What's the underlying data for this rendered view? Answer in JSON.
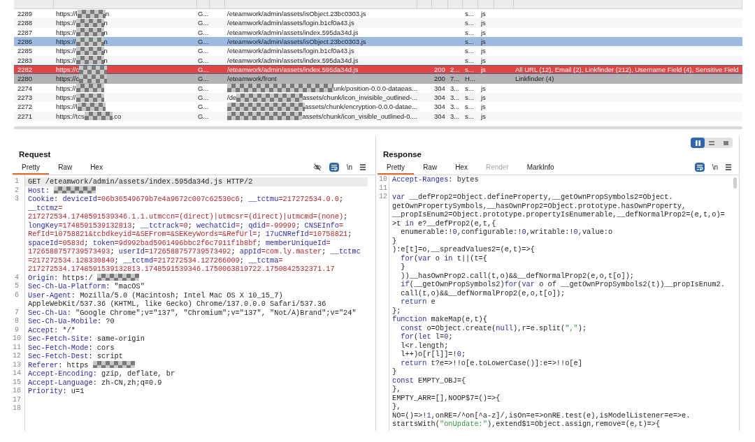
{
  "table": {
    "rows": [
      {
        "num": "2289",
        "host": [
          {
            "kind": "plain",
            "text": "https://l"
          },
          {
            "kind": "redacted"
          },
          {
            "kind": "plain",
            "text": "n"
          }
        ],
        "method": "G...",
        "url": [
          {
            "kind": "plain",
            "text": "/eteamwork/admin/assets/isObject.23bc0303.js"
          }
        ],
        "mime": "s...",
        "ext": "js",
        "selected": false
      },
      {
        "num": "2288",
        "host": [
          {
            "kind": "plain",
            "text": "https://"
          },
          {
            "kind": "redacted"
          },
          {
            "kind": "plain",
            "text": "n"
          }
        ],
        "method": "G...",
        "url": [
          {
            "kind": "plain",
            "text": "/eteamwork/admin/assets/login.b1cf0a43.js"
          }
        ],
        "mime": "s...",
        "ext": "js",
        "selected": false
      },
      {
        "num": "2287",
        "host": [
          {
            "kind": "plain",
            "text": "https://"
          },
          {
            "kind": "redacted"
          },
          {
            "kind": "plain",
            "text": "n"
          }
        ],
        "method": "G...",
        "url": [
          {
            "kind": "plain",
            "text": "/eteamwork/admin/assets/index.595da34d.js"
          }
        ],
        "mime": "s...",
        "ext": "js",
        "selected": false
      },
      {
        "num": "2286",
        "host": [
          {
            "kind": "plain",
            "text": "https://"
          },
          {
            "kind": "redacted"
          },
          {
            "kind": "plain",
            "text": "n"
          }
        ],
        "method": "G...",
        "url": [
          {
            "kind": "plain",
            "text": "/eteamwork/admin/assets/isObject.23bc0303.js"
          }
        ],
        "mime": "s...",
        "ext": "js",
        "selected": false,
        "color": "#9dbbe2"
      },
      {
        "num": "2285",
        "host": [
          {
            "kind": "plain",
            "text": "https://"
          },
          {
            "kind": "redacted"
          },
          {
            "kind": "plain",
            "text": "n"
          }
        ],
        "method": "G...",
        "url": [
          {
            "kind": "plain",
            "text": "/eteamwork/admin/assets/login.b1cf0a43.js"
          }
        ],
        "mime": "s...",
        "ext": "js",
        "selected": false
      },
      {
        "num": "2283",
        "host": [
          {
            "kind": "plain",
            "text": "https://"
          },
          {
            "kind": "redacted"
          },
          {
            "kind": "plain",
            "text": "n"
          }
        ],
        "method": "G...",
        "url": [
          {
            "kind": "plain",
            "text": "/eteamwork/admin/assets/index.595da34d.js"
          }
        ],
        "mime": "s...",
        "ext": "js",
        "selected": false
      },
      {
        "num": "2282",
        "host": [
          {
            "kind": "plain",
            "text": "https://c"
          },
          {
            "kind": "redacted"
          }
        ],
        "method": "G...",
        "url": [
          {
            "kind": "plain",
            "text": "/eteamwork/admin/assets/index.595da34d.js"
          }
        ],
        "status": "200",
        "length": "2...",
        "mime": "s...",
        "ext": "js",
        "notes": "All URL (12), Email (2), Linkfinder (212), Username Field (4), Sensitive Field",
        "selected": true,
        "color": "#df4646"
      },
      {
        "num": "2280",
        "host": [
          {
            "kind": "plain",
            "text": "https://c"
          },
          {
            "kind": "redacted"
          }
        ],
        "method": "G...",
        "url": [
          {
            "kind": "plain",
            "text": "/eteamwork/front"
          }
        ],
        "status": "200",
        "length": "7...",
        "mime": "H...",
        "notes": "Linkfinder (4)",
        "selected": false,
        "color": "#b3b3b3"
      },
      {
        "num": "2274",
        "host": [
          {
            "kind": "plain",
            "text": "https://"
          },
          {
            "kind": "redacted"
          }
        ],
        "method": "G...",
        "url": [
          {
            "kind": "redacted"
          },
          {
            "kind": "plain",
            "text": "unk/position-0.0.0-dataeas..."
          }
        ],
        "status": "304",
        "length": "3...",
        "mime": "s...",
        "ext": "js",
        "selected": false
      },
      {
        "num": "2273",
        "host": [
          {
            "kind": "plain",
            "text": "https://"
          },
          {
            "kind": "redacted"
          }
        ],
        "method": "G...",
        "url": [
          {
            "kind": "plain",
            "text": "/de"
          },
          {
            "kind": "redacted"
          },
          {
            "kind": "plain",
            "text": "assets/chunk/icon_invisible_outlined-..."
          }
        ],
        "status": "304",
        "length": "3...",
        "mime": "s...",
        "ext": "js",
        "selected": false
      },
      {
        "num": "2272",
        "host": [
          {
            "kind": "plain",
            "text": "https://l"
          },
          {
            "kind": "redacted"
          }
        ],
        "method": "G...",
        "url": [
          {
            "kind": "redacted"
          },
          {
            "kind": "plain",
            "text": "assets/chunk/encryption-0.0.0-datae..."
          }
        ],
        "status": "304",
        "length": "3...",
        "mime": "s...",
        "ext": "js",
        "selected": false
      },
      {
        "num": "2271",
        "host": [
          {
            "kind": "plain",
            "text": "https://tcs"
          },
          {
            "kind": "redacted"
          },
          {
            "kind": "plain",
            "text": ".co"
          }
        ],
        "method": "G...",
        "url": [
          {
            "kind": "redacted"
          },
          {
            "kind": "plain",
            "text": "assets/chunk/icon_visible_outlined-0...."
          }
        ],
        "status": "304",
        "length": "3...",
        "mime": "s...",
        "ext": "js",
        "selected": false
      }
    ]
  },
  "request": {
    "title": "Request",
    "tabs": [
      {
        "label": "Pretty",
        "selected": true
      },
      {
        "label": "Raw",
        "selected": false
      },
      {
        "label": "Hex",
        "selected": false
      }
    ],
    "wrap": true,
    "newline_label": "\\n",
    "rows": [
      {
        "number": "1",
        "current": true,
        "parts": [
          {
            "kind": "plain",
            "text": "GET /eteamwork/admin/assets/index.595da34d.js HTTP/2"
          }
        ]
      },
      {
        "number": "2",
        "current": false,
        "parts": [
          {
            "kind": "keyword",
            "text": "Host:"
          },
          {
            "kind": "redacted"
          }
        ]
      },
      {
        "number": "3",
        "current": false,
        "parts": [
          {
            "kind": "keyword",
            "text": "Cookie"
          },
          {
            "kind": "plain",
            "text": ": "
          },
          {
            "kind": "keyword",
            "text": "deviceId"
          },
          {
            "kind": "value",
            "text": "=06b36549679b7e4a9672c007c62530c6"
          },
          {
            "kind": "plain",
            "text": "; "
          },
          {
            "kind": "keyword",
            "text": "__tctmu"
          },
          {
            "kind": "value",
            "text": "=217272534.0.0"
          },
          {
            "kind": "plain",
            "text": ";"
          }
        ]
      },
      {
        "current": false,
        "parts": [
          {
            "kind": "keyword",
            "text": "__tctmz"
          },
          {
            "kind": "value",
            "text": "="
          }
        ]
      },
      {
        "current": false,
        "parts": [
          {
            "kind": "value",
            "text": "217272534.1748591539346.1.1.utmccn=(direct)|utmcsr=(direct)|utmcmd=(none)"
          },
          {
            "kind": "plain",
            "text": ";"
          }
        ]
      },
      {
        "current": false,
        "parts": [
          {
            "kind": "keyword",
            "text": "longKey"
          },
          {
            "kind": "value",
            "text": "=1748591539132813"
          },
          {
            "kind": "plain",
            "text": "; "
          },
          {
            "kind": "keyword",
            "text": "__tctrack"
          },
          {
            "kind": "value",
            "text": "=0"
          },
          {
            "kind": "plain",
            "text": "; "
          },
          {
            "kind": "keyword",
            "text": "wechatCid"
          },
          {
            "kind": "value",
            "text": "="
          },
          {
            "kind": "plain",
            "text": "; "
          },
          {
            "kind": "keyword",
            "text": "qdid"
          },
          {
            "kind": "value",
            "text": "=-99999"
          },
          {
            "kind": "plain",
            "text": "; "
          },
          {
            "kind": "keyword",
            "text": "CNSEInfo"
          },
          {
            "kind": "value",
            "text": "="
          }
        ]
      },
      {
        "current": false,
        "parts": [
          {
            "kind": "value",
            "text": "RefId=10758821&tcbdkeyid=&SEFrom=&SEKeyWords=&RefUrl="
          },
          {
            "kind": "plain",
            "text": "; "
          },
          {
            "kind": "keyword",
            "text": "17uCNRefId"
          },
          {
            "kind": "value",
            "text": "=10758821"
          },
          {
            "kind": "plain",
            "text": ";"
          }
        ]
      },
      {
        "current": false,
        "parts": [
          {
            "kind": "keyword",
            "text": "spaceId"
          },
          {
            "kind": "value",
            "text": "=0583d"
          },
          {
            "kind": "plain",
            "text": "; "
          },
          {
            "kind": "keyword",
            "text": "token"
          },
          {
            "kind": "value",
            "text": "=9d992bad5961496bbc2f6c7911f1b8bf"
          },
          {
            "kind": "plain",
            "text": "; "
          },
          {
            "kind": "keyword",
            "text": "memberUniqueId"
          },
          {
            "kind": "value",
            "text": "="
          }
        ]
      },
      {
        "current": false,
        "parts": [
          {
            "kind": "value",
            "text": "1726588757739573493"
          },
          {
            "kind": "plain",
            "text": "; "
          },
          {
            "kind": "keyword",
            "text": "userId"
          },
          {
            "kind": "value",
            "text": "=1726588757739573492"
          },
          {
            "kind": "plain",
            "text": "; "
          },
          {
            "kind": "keyword",
            "text": "appId"
          },
          {
            "kind": "value",
            "text": "=com.ly.master"
          },
          {
            "kind": "plain",
            "text": "; "
          },
          {
            "kind": "keyword",
            "text": "__tctmc"
          }
        ]
      },
      {
        "current": false,
        "parts": [
          {
            "kind": "value",
            "text": "=217272534.128330840"
          },
          {
            "kind": "plain",
            "text": "; "
          },
          {
            "kind": "keyword",
            "text": "__tctmd"
          },
          {
            "kind": "value",
            "text": "=217272534.127266009"
          },
          {
            "kind": "plain",
            "text": "; "
          },
          {
            "kind": "keyword",
            "text": "__tctma"
          },
          {
            "kind": "value",
            "text": "="
          }
        ]
      },
      {
        "current": false,
        "parts": [
          {
            "kind": "value",
            "text": "217272534.1748591539132813.1748591539346.1750063819722.1750842532371.17"
          }
        ]
      },
      {
        "number": "4",
        "current": false,
        "parts": [
          {
            "kind": "keyword",
            "text": "Origin"
          },
          {
            "kind": "plain",
            "text": ": https:/"
          },
          {
            "kind": "redacted"
          }
        ]
      },
      {
        "number": "5",
        "current": false,
        "parts": [
          {
            "kind": "keyword",
            "text": "Sec-Ch-Ua-Platform"
          },
          {
            "kind": "plain",
            "text": ": \"macOS\""
          }
        ]
      },
      {
        "number": "6",
        "current": false,
        "parts": [
          {
            "kind": "keyword",
            "text": "User-Agent"
          },
          {
            "kind": "plain",
            "text": ": Mozilla/5.0 (Macintosh; Intel Mac OS X 10_15_7)"
          }
        ]
      },
      {
        "current": false,
        "parts": [
          {
            "kind": "plain",
            "text": "AppleWebKit/537.36 (KHTML, like Gecko) Chrome/137.0.0.0 Safari/537.36"
          }
        ]
      },
      {
        "number": "7",
        "current": false,
        "parts": [
          {
            "kind": "keyword",
            "text": "Sec-Ch-Ua"
          },
          {
            "kind": "plain",
            "text": ": \"Google Chrome\";v=\"137\", \"Chromium\";v=\"137\", \"Not/A)Brand\";v=\"24\""
          }
        ]
      },
      {
        "number": "8",
        "current": false,
        "parts": [
          {
            "kind": "keyword",
            "text": "Sec-Ch-Ua-Mobile"
          },
          {
            "kind": "plain",
            "text": ": ?0"
          }
        ]
      },
      {
        "number": "9",
        "current": false,
        "parts": [
          {
            "kind": "keyword",
            "text": "Accept"
          },
          {
            "kind": "plain",
            "text": ": */*"
          }
        ]
      },
      {
        "number": "10",
        "current": false,
        "parts": [
          {
            "kind": "keyword",
            "text": "Sec-Fetch-Site"
          },
          {
            "kind": "plain",
            "text": ": same-origin"
          }
        ]
      },
      {
        "number": "11",
        "current": false,
        "parts": [
          {
            "kind": "keyword",
            "text": "Sec-Fetch-Mode"
          },
          {
            "kind": "plain",
            "text": ": cors"
          }
        ]
      },
      {
        "number": "12",
        "current": false,
        "parts": [
          {
            "kind": "keyword",
            "text": "Sec-Fetch-Dest"
          },
          {
            "kind": "plain",
            "text": ": script"
          }
        ]
      },
      {
        "number": "13",
        "current": false,
        "parts": [
          {
            "kind": "keyword",
            "text": "Referer"
          },
          {
            "kind": "plain",
            "text": ": https"
          },
          {
            "kind": "redacted"
          }
        ]
      },
      {
        "number": "14",
        "current": false,
        "parts": [
          {
            "kind": "keyword",
            "text": "Accept-Encoding"
          },
          {
            "kind": "plain",
            "text": ": gzip, deflate, br"
          }
        ]
      },
      {
        "number": "15",
        "current": false,
        "parts": [
          {
            "kind": "keyword",
            "text": "Accept-Language"
          },
          {
            "kind": "plain",
            "text": ": zh-CN,zh;q=0.9"
          }
        ]
      },
      {
        "number": "16",
        "current": false,
        "parts": [
          {
            "kind": "keyword",
            "text": "Priority"
          },
          {
            "kind": "plain",
            "text": ": u=1"
          }
        ]
      },
      {
        "number": "17",
        "current": false
      },
      {
        "number": "18",
        "current": false
      }
    ]
  },
  "response": {
    "view_modes": [
      {
        "kind": "columns",
        "selected": true
      },
      {
        "kind": "rows",
        "selected": false
      },
      {
        "kind": "single",
        "selected": false
      }
    ],
    "title": "Response",
    "tabs": [
      {
        "label": "Pretty",
        "selected": true,
        "disabled": false
      },
      {
        "label": "Raw",
        "selected": false,
        "disabled": false
      },
      {
        "label": "Hex",
        "selected": false,
        "disabled": false
      },
      {
        "label": "Render",
        "selected": false,
        "disabled": true
      },
      {
        "label": "MarkInfo",
        "selected": false,
        "disabled": false
      }
    ],
    "wrap": true,
    "newline_label": "\\n",
    "rows": [
      {
        "number": "10",
        "parts": [
          {
            "kind": "keyword",
            "text": "Accept-Ranges"
          },
          {
            "kind": "plain",
            "text": ": bytes"
          }
        ]
      },
      {
        "number": "11"
      },
      {
        "number": "12",
        "parts": [
          {
            "kind": "keyword",
            "text": "var"
          },
          {
            "kind": "plain",
            "text": " __defProp2=Object.defineProperty,__getOwnPropSymbols2=Object."
          }
        ]
      },
      {
        "parts": [
          {
            "kind": "plain",
            "text": "getOwnPropertySymbols,__hasOwnProp2=Object.prototype.hasOwnProperty,"
          }
        ]
      },
      {
        "parts": [
          {
            "kind": "plain",
            "text": "__propIsEnum2=Object.prototype.propertyIsEnumerable,__defNormalProp2=(e,t,o)="
          }
        ]
      },
      {
        "parts": [
          {
            "kind": "plain",
            "text": ">t "
          },
          {
            "kind": "keyword",
            "text": "in"
          },
          {
            "kind": "plain",
            "text": " e?__defProp2(e,t,{"
          }
        ]
      },
      {
        "parts": [
          {
            "kind": "plain",
            "text": "  enumerable:!"
          },
          {
            "kind": "keyword",
            "text": "0"
          },
          {
            "kind": "plain",
            "text": ",configurable:!"
          },
          {
            "kind": "keyword",
            "text": "0"
          },
          {
            "kind": "plain",
            "text": ",writable:!"
          },
          {
            "kind": "keyword",
            "text": "0"
          },
          {
            "kind": "plain",
            "text": ",value:o"
          }
        ]
      },
      {
        "parts": [
          {
            "kind": "plain",
            "text": "}"
          }
        ]
      },
      {
        "parts": [
          {
            "kind": "plain",
            "text": "):e[t]=o,__spreadValues2=(e,t)=>{"
          }
        ]
      },
      {
        "parts": [
          {
            "kind": "keyword",
            "text": "  for"
          },
          {
            "kind": "plain",
            "text": "("
          },
          {
            "kind": "keyword",
            "text": "var"
          },
          {
            "kind": "plain",
            "text": " o "
          },
          {
            "kind": "keyword",
            "text": "in"
          },
          {
            "kind": "plain",
            "text": " t||(t={"
          }
        ]
      },
      {
        "parts": [
          {
            "kind": "plain",
            "text": "  }"
          }
        ]
      },
      {
        "parts": [
          {
            "kind": "plain",
            "text": "  ))__hasOwnProp2.call(t,o)&&__defNormalProp2(e,o,t[o]);"
          }
        ]
      },
      {
        "parts": [
          {
            "kind": "keyword",
            "text": "  if"
          },
          {
            "kind": "plain",
            "text": "(__getOwnPropSymbols2)"
          },
          {
            "kind": "keyword",
            "text": "for"
          },
          {
            "kind": "plain",
            "text": "("
          },
          {
            "kind": "keyword",
            "text": "var"
          },
          {
            "kind": "plain",
            "text": " o of __getOwnPropSymbols2(t))__propIsEnum2."
          }
        ]
      },
      {
        "parts": [
          {
            "kind": "plain",
            "text": "  call(t,o)&&__defNormalProp2(e,o,t[o]);"
          }
        ]
      },
      {
        "parts": [
          {
            "kind": "keyword",
            "text": "  return"
          },
          {
            "kind": "plain",
            "text": " e"
          }
        ]
      },
      {
        "parts": [
          {
            "kind": "plain",
            "text": "};"
          }
        ]
      },
      {
        "parts": [
          {
            "kind": "keyword",
            "text": "function"
          },
          {
            "kind": "plain",
            "text": " makeMap(e,t){"
          }
        ]
      },
      {
        "parts": [
          {
            "kind": "keyword",
            "text": "  const"
          },
          {
            "kind": "plain",
            "text": " o=Object.create("
          },
          {
            "kind": "keyword",
            "text": "null"
          },
          {
            "kind": "plain",
            "text": "),r=e.split("
          },
          {
            "kind": "string",
            "text": "\",\""
          },
          {
            "kind": "plain",
            "text": ");"
          }
        ]
      },
      {
        "parts": [
          {
            "kind": "keyword",
            "text": "  for"
          },
          {
            "kind": "plain",
            "text": "("
          },
          {
            "kind": "keyword",
            "text": "let"
          },
          {
            "kind": "plain",
            "text": " l="
          },
          {
            "kind": "keyword",
            "text": "0"
          },
          {
            "kind": "plain",
            "text": ";"
          }
        ]
      },
      {
        "parts": [
          {
            "kind": "plain",
            "text": "  l<r.length;"
          }
        ]
      },
      {
        "parts": [
          {
            "kind": "plain",
            "text": "  l++)o[r[l]]=!"
          },
          {
            "kind": "keyword",
            "text": "0"
          },
          {
            "kind": "plain",
            "text": ";"
          }
        ]
      },
      {
        "parts": [
          {
            "kind": "keyword",
            "text": "  return"
          },
          {
            "kind": "plain",
            "text": " t?e=>!!o[e.toLowerCase()]:e=>!!o[e]"
          }
        ]
      },
      {
        "parts": [
          {
            "kind": "plain",
            "text": "}"
          }
        ]
      },
      {
        "parts": [
          {
            "kind": "keyword",
            "text": "const"
          },
          {
            "kind": "plain",
            "text": " EMPTY_OBJ={"
          }
        ]
      },
      {
        "parts": [
          {
            "kind": "plain",
            "text": "},"
          }
        ]
      },
      {
        "parts": [
          {
            "kind": "plain",
            "text": "EMPTY_ARR=[],NOOP$7=()=>{"
          }
        ]
      },
      {
        "parts": [
          {
            "kind": "plain",
            "text": "},"
          }
        ]
      },
      {
        "parts": [
          {
            "kind": "plain",
            "text": "NO=()=>!"
          },
          {
            "kind": "keyword",
            "text": "1"
          },
          {
            "kind": "plain",
            "text": ",onRE=/^on[^a-z]/,isOn=e=>onRE.test(e),isModelListener=e=>e."
          }
        ]
      },
      {
        "parts": [
          {
            "kind": "plain",
            "text": "startsWith("
          },
          {
            "kind": "string",
            "text": "\"onUpdate:\""
          },
          {
            "kind": "plain",
            "text": "),extend$1=Object.assign,remove=(e,t)=>{"
          }
        ]
      }
    ]
  }
}
